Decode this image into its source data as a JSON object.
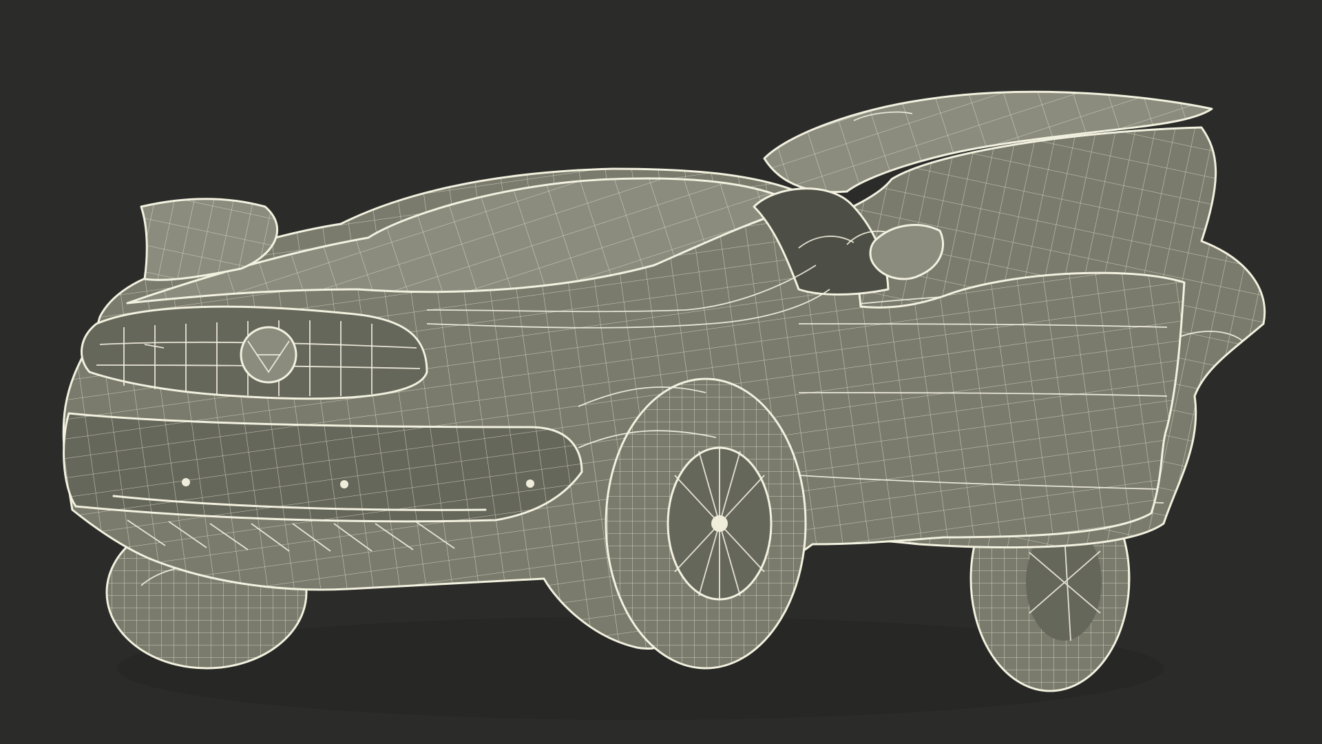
{
  "scene": {
    "subject": "wireframe-suv-render",
    "background_color": "#2b2b29",
    "mesh_color": "#7a7b6d",
    "wire_color": "#f0eedb"
  }
}
